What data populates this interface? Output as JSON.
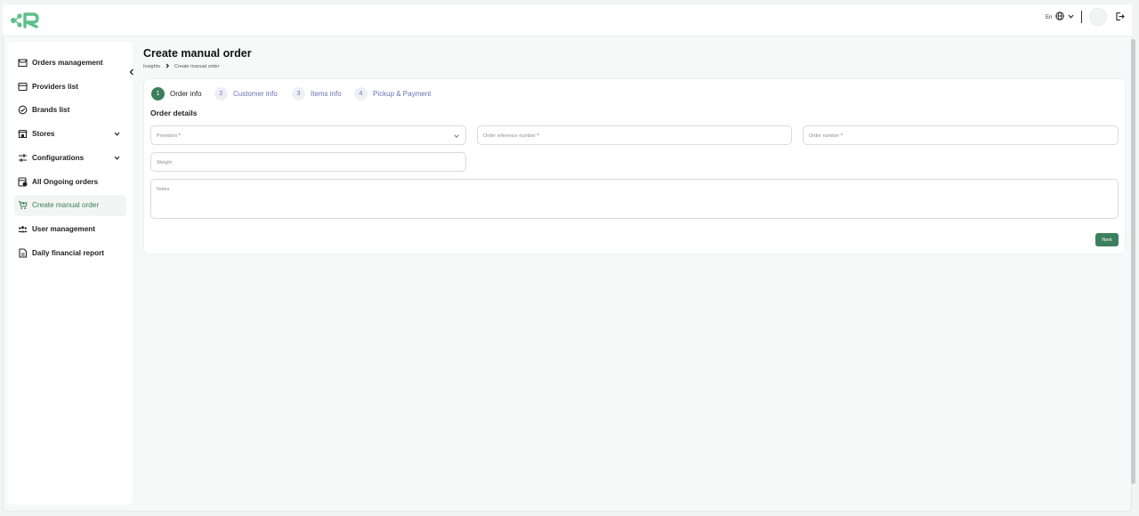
{
  "header": {
    "logo_icon": "logo-mark",
    "language": "En",
    "globe_icon": "globe-icon",
    "logout_icon": "logout-icon"
  },
  "sidebar": {
    "items": [
      {
        "label": "Orders management",
        "icon": "orders-icon"
      },
      {
        "label": "Providers list",
        "icon": "providers-icon"
      },
      {
        "label": "Brands list",
        "icon": "brands-icon"
      },
      {
        "label": "Stores",
        "icon": "store-icon",
        "expandable": true
      },
      {
        "label": "Configurations",
        "icon": "sliders-icon",
        "expandable": true
      },
      {
        "label": "All Ongoing orders",
        "icon": "ongoing-orders-icon"
      },
      {
        "label": "Create manual order",
        "icon": "cart-icon",
        "active": true
      },
      {
        "label": "User management",
        "icon": "users-icon"
      },
      {
        "label": "Daily financial report",
        "icon": "report-icon"
      }
    ]
  },
  "page": {
    "title": "Create manual order",
    "breadcrumb": [
      "Insights",
      "Create manual order"
    ]
  },
  "steps": [
    {
      "number": "1",
      "label": "Order info",
      "active": true
    },
    {
      "number": "2",
      "label": "Customer info"
    },
    {
      "number": "3",
      "label": "Items info"
    },
    {
      "number": "4",
      "label": "Pickup & Payment"
    }
  ],
  "form": {
    "section_title": "Order details",
    "providers": {
      "placeholder": "Providers",
      "required_mark": "*"
    },
    "order_reference": {
      "placeholder": "Order reference number",
      "required_mark": "*"
    },
    "order_number": {
      "placeholder": "Order number",
      "required_mark": "*"
    },
    "weight": {
      "placeholder": "Weight"
    },
    "notes": {
      "placeholder": "Notes"
    },
    "next_label": "Next"
  },
  "colors": {
    "accent": "#3c7f5c",
    "step_inactive": "#6a73b5",
    "required": "#e0303a"
  }
}
